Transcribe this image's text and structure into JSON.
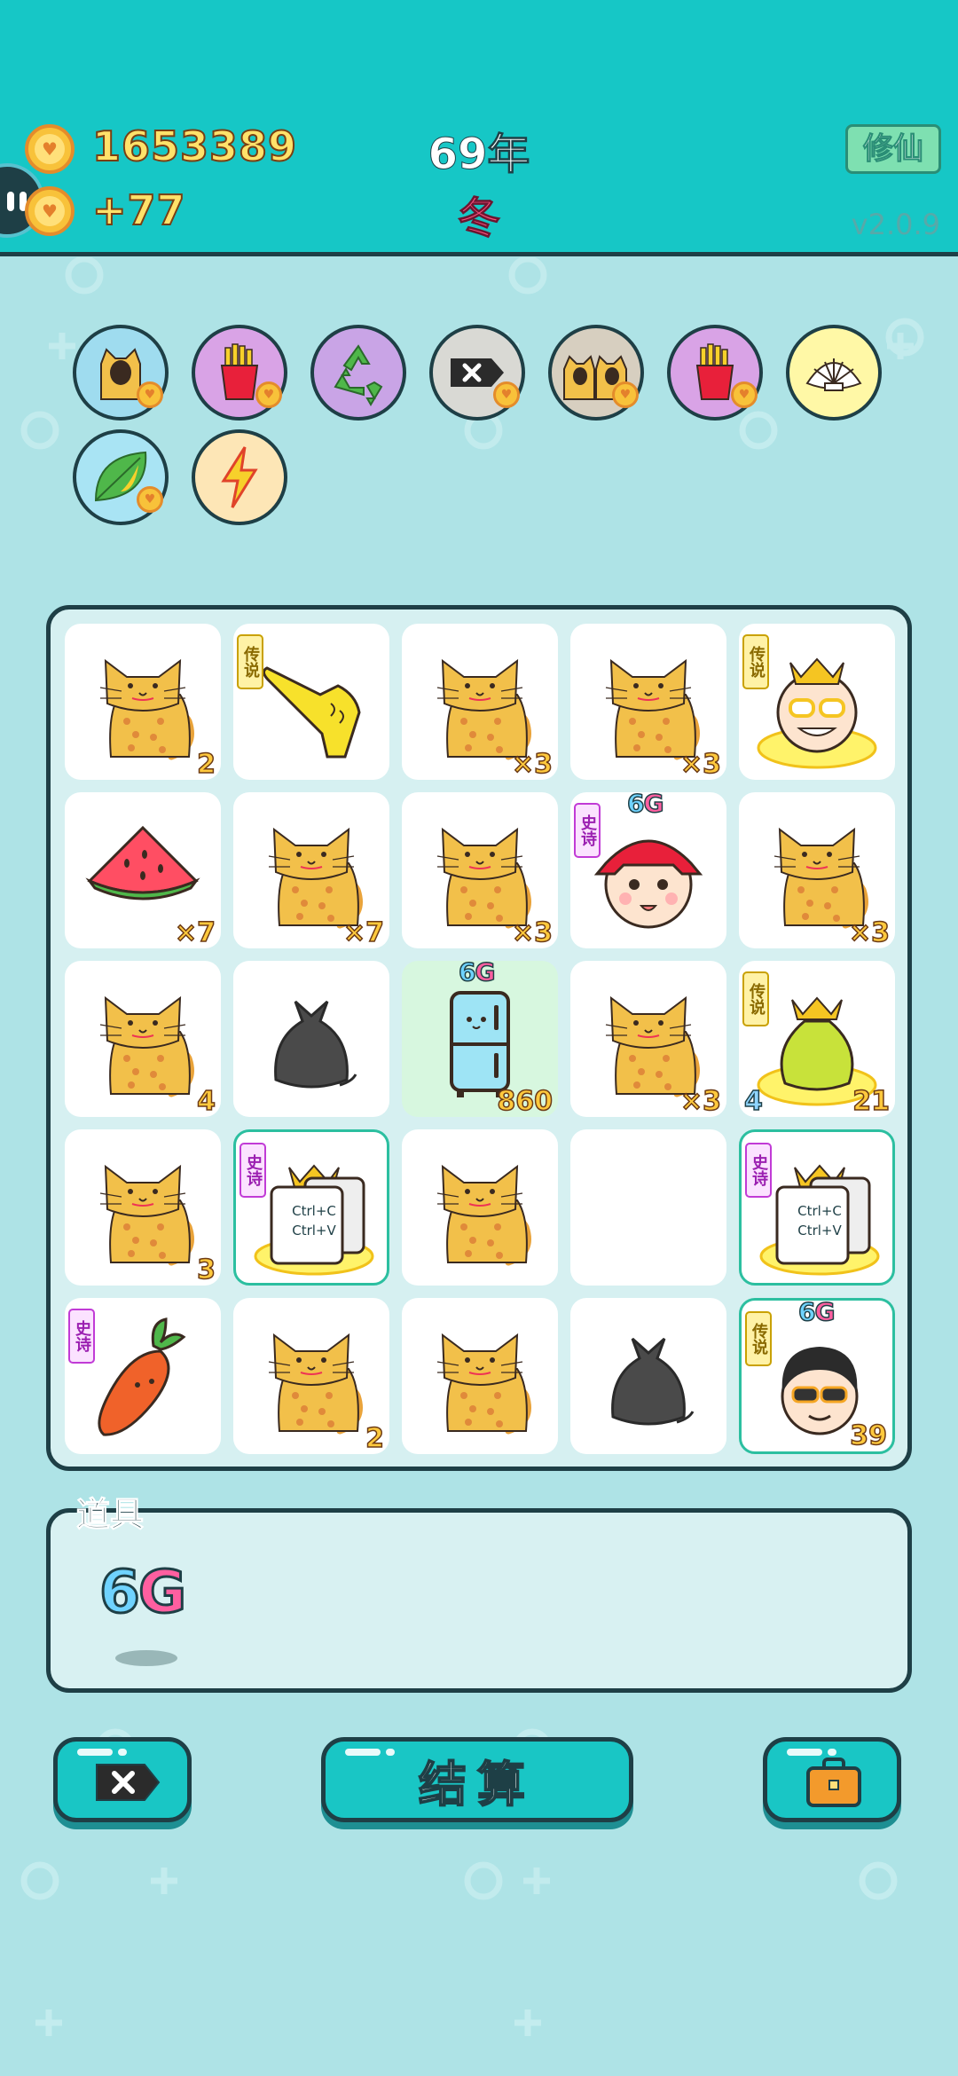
{
  "header": {
    "coins": "1653389",
    "income": "+77",
    "year": "69年",
    "season": "冬",
    "mode_button": "修仙",
    "version": "v2.0.9",
    "coin_color": "#f8c23a"
  },
  "buffs": [
    {
      "icon": "cat-hole-icon",
      "bg": "#9fdcef",
      "heart": true
    },
    {
      "icon": "fries-icon",
      "bg": "#d9a3e6",
      "heart": true
    },
    {
      "icon": "recycle-icon",
      "bg": "#c9a4e6",
      "heart": false
    },
    {
      "icon": "remove-tag-icon",
      "bg": "#d9d9d4",
      "heart": true
    },
    {
      "icon": "cat-twins-icon",
      "bg": "#d7cfc0",
      "heart": true
    },
    {
      "icon": "fries-icon",
      "bg": "#d9a3e6",
      "heart": true
    },
    {
      "icon": "shell-icon",
      "bg": "#fff8a6",
      "heart": false
    },
    {
      "icon": "leaf-icon",
      "bg": "#a9e4f4",
      "heart": true
    },
    {
      "icon": "lightning-icon",
      "bg": "#fde6b6",
      "heart": false
    }
  ],
  "board": {
    "cells": [
      {
        "item": "cat",
        "count": "2"
      },
      {
        "item": "pointing-hand",
        "tag": "传说"
      },
      {
        "item": "cat",
        "count": "×3"
      },
      {
        "item": "cat",
        "count": "×3"
      },
      {
        "item": "king-glasses",
        "tag": "传说"
      },
      {
        "item": "watermelon",
        "count": "×7"
      },
      {
        "item": "cat",
        "count": "×7"
      },
      {
        "item": "cat",
        "count": "×3"
      },
      {
        "item": "red-hat-face",
        "tag": "史诗",
        "sixg": true
      },
      {
        "item": "cat",
        "count": "×3"
      },
      {
        "item": "cat",
        "count": "4"
      },
      {
        "item": "trash-bag"
      },
      {
        "item": "fridge",
        "count": "860",
        "sixg": true,
        "green": true
      },
      {
        "item": "cat",
        "count": "×3"
      },
      {
        "item": "gold-bag",
        "tag": "传说",
        "count": "21",
        "level": "4"
      },
      {
        "item": "cat",
        "count": "3"
      },
      {
        "item": "ctrlcv",
        "tag": "史诗",
        "outlined": true
      },
      {
        "item": "cat"
      },
      {
        "item": "empty"
      },
      {
        "item": "ctrlcv",
        "tag": "史诗",
        "outlined": true
      },
      {
        "item": "carrot",
        "tag": "史诗"
      },
      {
        "item": "cat",
        "count": "2"
      },
      {
        "item": "cat"
      },
      {
        "item": "trash-bag"
      },
      {
        "item": "sunglasses-man",
        "tag": "传说",
        "count": "39",
        "sixg": true,
        "outlined": true
      }
    ],
    "ctrl_text": [
      "Ctrl+C",
      "Ctrl+V"
    ],
    "sixg_text": [
      "6",
      "G"
    ]
  },
  "props": {
    "label": "道具",
    "item_text": [
      "6",
      "G"
    ]
  },
  "buttons": {
    "remove": "remove-tag-icon",
    "settle": "结算",
    "bag": "briefcase-icon"
  }
}
